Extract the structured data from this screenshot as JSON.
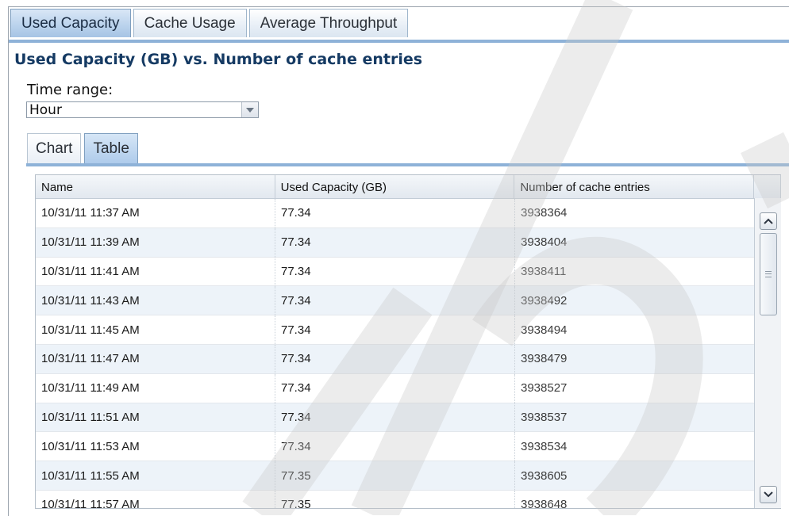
{
  "top_tabs": [
    {
      "label": "Used Capacity",
      "active": true
    },
    {
      "label": "Cache Usage",
      "active": false
    },
    {
      "label": "Average Throughput",
      "active": false
    }
  ],
  "title": "Used Capacity (GB) vs. Number of cache entries",
  "time_range": {
    "label": "Time range:",
    "value": "Hour"
  },
  "sub_tabs": [
    {
      "label": "Chart",
      "active": false
    },
    {
      "label": "Table",
      "active": true
    }
  ],
  "table": {
    "headers": [
      "Name",
      "Used Capacity (GB)",
      "Number of cache entries"
    ],
    "rows": [
      [
        "10/31/11 11:37 AM",
        "77.34",
        "3938364"
      ],
      [
        "10/31/11 11:39 AM",
        "77.34",
        "3938404"
      ],
      [
        "10/31/11 11:41 AM",
        "77.34",
        "3938411"
      ],
      [
        "10/31/11 11:43 AM",
        "77.34",
        "3938492"
      ],
      [
        "10/31/11 11:45 AM",
        "77.34",
        "3938494"
      ],
      [
        "10/31/11 11:47 AM",
        "77.34",
        "3938479"
      ],
      [
        "10/31/11 11:49 AM",
        "77.34",
        "3938527"
      ],
      [
        "10/31/11 11:51 AM",
        "77.34",
        "3938537"
      ],
      [
        "10/31/11 11:53 AM",
        "77.34",
        "3938534"
      ],
      [
        "10/31/11 11:55 AM",
        "77.35",
        "3938605"
      ],
      [
        "10/31/11 11:57 AM",
        "77.35",
        "3938648"
      ]
    ]
  },
  "colors": {
    "title": "#153a63",
    "tab_active": "#b9d2ec",
    "row_alt": "#edf3f9",
    "accent_line": "#8eb2d8"
  },
  "icons": {
    "dropdown": "chevron-down-icon",
    "scroll_up": "arrow-up-icon",
    "scroll_down": "arrow-down-icon",
    "thumb_grip": "grip-icon"
  }
}
